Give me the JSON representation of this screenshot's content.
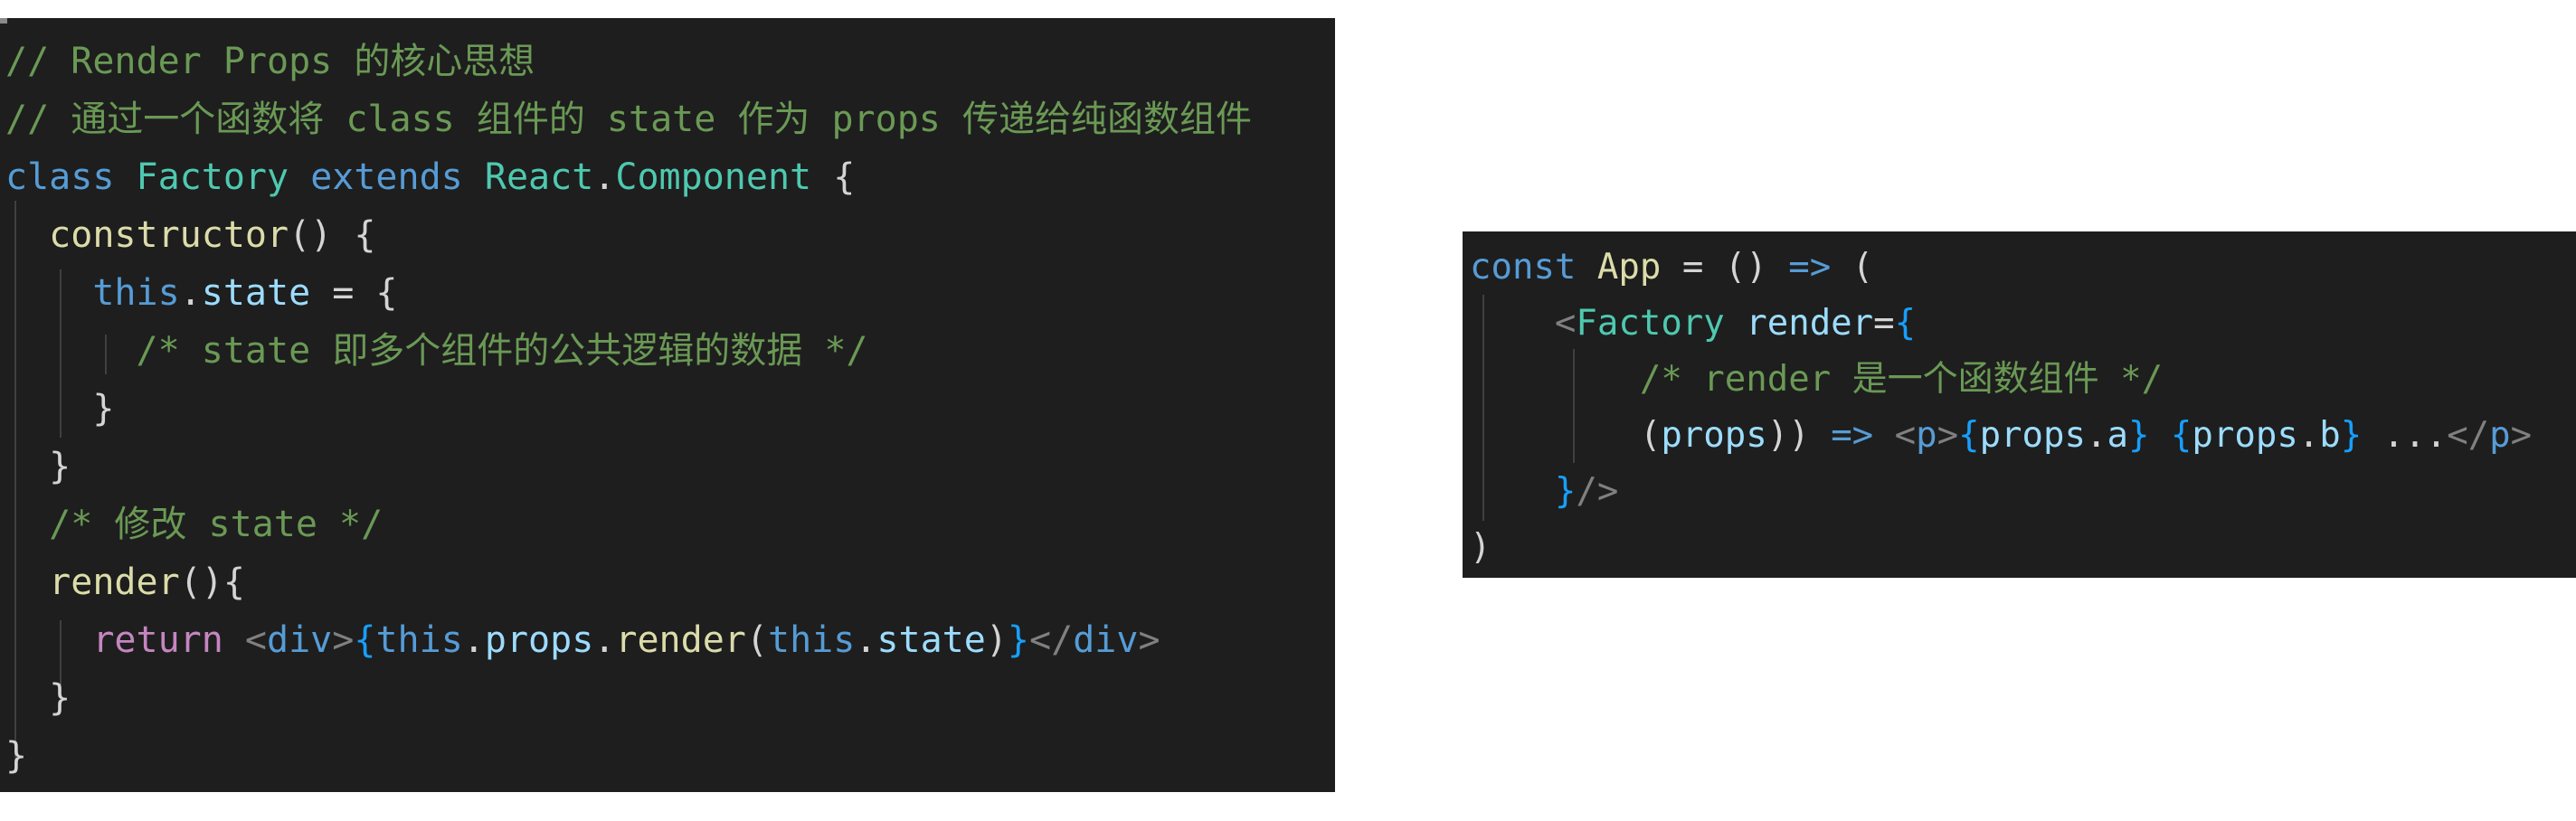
{
  "colors": {
    "background": "#1e1e1e",
    "comment": "#6a9955",
    "keyword": "#569cd6",
    "class_name": "#4ec9b0",
    "function": "#dcdcaa",
    "variable": "#9cdcfe",
    "control": "#c586c0",
    "tag_bracket": "#808080",
    "text": "#d4d4d4",
    "brace_gold": "#ffd700",
    "brace_purple": "#da70d6",
    "brace_blue": "#179fff"
  },
  "left_code": {
    "lines": [
      [
        {
          "t": "// Render Props 的核心思想",
          "c": "comment"
        }
      ],
      [
        {
          "t": "// 通过一个函数将 class 组件的 state 作为 props 传递给纯函数组件",
          "c": "comment"
        }
      ],
      [
        {
          "t": "class",
          "c": "keyword"
        },
        {
          "t": " "
        },
        {
          "t": "Factory",
          "c": "class_name"
        },
        {
          "t": " "
        },
        {
          "t": "extends",
          "c": "keyword"
        },
        {
          "t": " "
        },
        {
          "t": "React",
          "c": "class_name"
        },
        {
          "t": "."
        },
        {
          "t": "Component",
          "c": "class_name"
        },
        {
          "t": " "
        },
        {
          "t": "{",
          "c": "text"
        }
      ],
      [
        {
          "t": "  "
        },
        {
          "t": "constructor",
          "c": "function"
        },
        {
          "t": "() {",
          "c": "text"
        }
      ],
      [
        {
          "t": "    "
        },
        {
          "t": "this",
          "c": "keyword"
        },
        {
          "t": "."
        },
        {
          "t": "state",
          "c": "variable"
        },
        {
          "t": " = {",
          "c": "text"
        }
      ],
      [
        {
          "t": "      "
        },
        {
          "t": "/* state 即多个组件的公共逻辑的数据 */",
          "c": "comment"
        }
      ],
      [
        {
          "t": "    "
        },
        {
          "t": "}",
          "c": "text"
        }
      ],
      [
        {
          "t": "  "
        },
        {
          "t": "}",
          "c": "text"
        }
      ],
      [
        {
          "t": "  "
        },
        {
          "t": "/* 修改 state */",
          "c": "comment"
        }
      ],
      [
        {
          "t": "  "
        },
        {
          "t": "render",
          "c": "function"
        },
        {
          "t": "(){",
          "c": "text"
        }
      ],
      [
        {
          "t": "    "
        },
        {
          "t": "return",
          "c": "control"
        },
        {
          "t": " "
        },
        {
          "t": "<",
          "c": "tag_bracket"
        },
        {
          "t": "div",
          "c": "keyword"
        },
        {
          "t": ">",
          "c": "tag_bracket"
        },
        {
          "t": "{",
          "c": "brace_blue"
        },
        {
          "t": "this",
          "c": "keyword"
        },
        {
          "t": "."
        },
        {
          "t": "props",
          "c": "variable"
        },
        {
          "t": "."
        },
        {
          "t": "render",
          "c": "function"
        },
        {
          "t": "(",
          "c": "text"
        },
        {
          "t": "this",
          "c": "keyword"
        },
        {
          "t": "."
        },
        {
          "t": "state",
          "c": "variable"
        },
        {
          "t": ")",
          "c": "text"
        },
        {
          "t": "}",
          "c": "brace_blue"
        },
        {
          "t": "</",
          "c": "tag_bracket"
        },
        {
          "t": "div",
          "c": "keyword"
        },
        {
          "t": ">",
          "c": "tag_bracket"
        }
      ],
      [
        {
          "t": "  "
        },
        {
          "t": "}",
          "c": "text"
        }
      ],
      [
        {
          "t": "}",
          "c": "text"
        }
      ]
    ]
  },
  "right_code": {
    "lines": [
      [
        {
          "t": "const",
          "c": "keyword"
        },
        {
          "t": " "
        },
        {
          "t": "App",
          "c": "function"
        },
        {
          "t": " = () "
        },
        {
          "t": "=>",
          "c": "keyword"
        },
        {
          "t": " ("
        }
      ],
      [
        {
          "t": "    "
        },
        {
          "t": "<",
          "c": "tag_bracket"
        },
        {
          "t": "Factory",
          "c": "class_name"
        },
        {
          "t": " "
        },
        {
          "t": "render",
          "c": "variable"
        },
        {
          "t": "="
        },
        {
          "t": "{",
          "c": "brace_blue"
        }
      ],
      [
        {
          "t": "        "
        },
        {
          "t": "/* render 是一个函数组件 */",
          "c": "comment"
        }
      ],
      [
        {
          "t": "        "
        },
        {
          "t": "(",
          "c": "text"
        },
        {
          "t": "props",
          "c": "variable"
        },
        {
          "t": "))",
          "c": "text"
        },
        {
          "t": " "
        },
        {
          "t": "=>",
          "c": "keyword"
        },
        {
          "t": " "
        },
        {
          "t": "<",
          "c": "tag_bracket"
        },
        {
          "t": "p",
          "c": "keyword"
        },
        {
          "t": ">",
          "c": "tag_bracket"
        },
        {
          "t": "{",
          "c": "brace_blue"
        },
        {
          "t": "props",
          "c": "variable"
        },
        {
          "t": "."
        },
        {
          "t": "a",
          "c": "variable"
        },
        {
          "t": "}",
          "c": "brace_blue"
        },
        {
          "t": " "
        },
        {
          "t": "{",
          "c": "brace_blue"
        },
        {
          "t": "props",
          "c": "variable"
        },
        {
          "t": "."
        },
        {
          "t": "b",
          "c": "variable"
        },
        {
          "t": "}",
          "c": "brace_blue"
        },
        {
          "t": " ..."
        },
        {
          "t": "</",
          "c": "tag_bracket"
        },
        {
          "t": "p",
          "c": "keyword"
        },
        {
          "t": ">",
          "c": "tag_bracket"
        }
      ],
      [
        {
          "t": "    "
        },
        {
          "t": "}",
          "c": "brace_blue"
        },
        {
          "t": "/>",
          "c": "tag_bracket"
        }
      ],
      [
        {
          "t": ")",
          "c": "text"
        }
      ]
    ]
  }
}
